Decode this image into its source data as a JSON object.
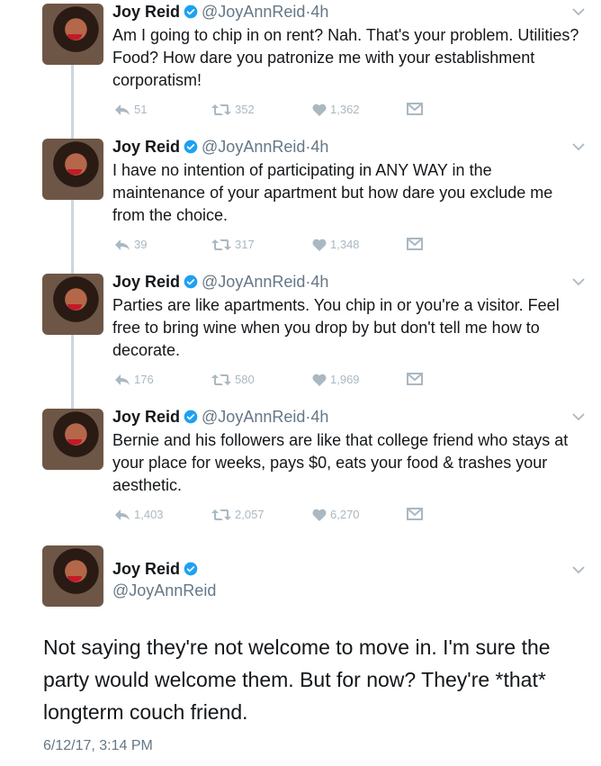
{
  "user": {
    "name": "Joy Reid",
    "handle": "@JoyAnnReid",
    "time_ago": "4h",
    "separator": "·"
  },
  "tweets": [
    {
      "text": "Am I going to chip in on rent? Nah. That's your problem. Utilities? Food? How dare you patronize me with your establishment corporatism!",
      "replies": "51",
      "retweets": "352",
      "likes": "1,362"
    },
    {
      "text": "I have no intention of participating in ANY WAY in the maintenance of your apartment but how dare you exclude me from the choice.",
      "replies": "39",
      "retweets": "317",
      "likes": "1,348"
    },
    {
      "text": "Parties are like apartments. You chip in or you're a visitor. Feel free to bring wine when you drop by but don't tell me how to decorate.",
      "replies": "176",
      "retweets": "580",
      "likes": "1,969"
    },
    {
      "text": "Bernie and his followers are like that college friend who stays at your place for weeks, pays $0, eats your food & trashes your aesthetic.",
      "replies": "1,403",
      "retweets": "2,057",
      "likes": "6,270"
    }
  ],
  "focused_tweet": {
    "text": "Not saying they're not welcome to move in. I'm sure the party would welcome them. But for now? They're *that* longterm couch friend.",
    "timestamp": "6/12/17, 3:14 PM"
  },
  "colors": {
    "verified": "#1da1f2",
    "muted": "#aab8c2",
    "handle": "#657786",
    "thread_line": "#ccd6dd"
  },
  "icons": [
    "reply-icon",
    "retweet-icon",
    "like-icon",
    "dm-icon",
    "verified-icon",
    "chevron-down-icon"
  ]
}
